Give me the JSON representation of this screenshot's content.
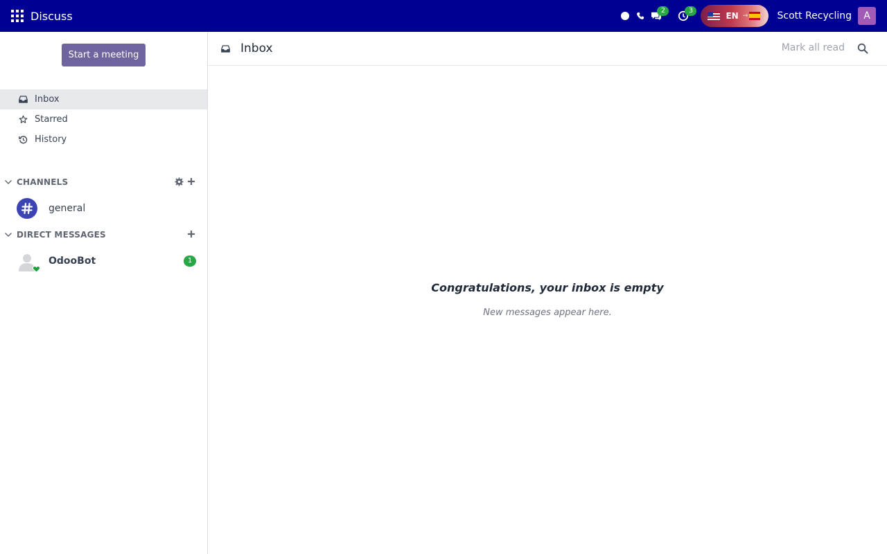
{
  "navbar": {
    "app_name": "Discuss",
    "messages_badge": "2",
    "activities_badge": "3",
    "language": "EN",
    "company": "Scott Recycling",
    "user_initial": "A"
  },
  "sidebar": {
    "start_meeting_label": "Start a meeting",
    "mailboxes": [
      {
        "label": "Inbox",
        "icon": "inbox-icon",
        "active": true
      },
      {
        "label": "Starred",
        "icon": "star-icon"
      },
      {
        "label": "History",
        "icon": "history-icon"
      }
    ],
    "channels": {
      "header": "CHANNELS",
      "items": [
        {
          "name": "general",
          "icon": "hashtag-icon"
        }
      ]
    },
    "direct_messages": {
      "header": "DIRECT MESSAGES",
      "items": [
        {
          "name": "OdooBot",
          "unread": "1",
          "status": "online"
        }
      ]
    }
  },
  "main": {
    "title": "Inbox",
    "mark_all_read": "Mark all read",
    "empty_title": "Congratulations, your inbox is empty",
    "empty_subtitle": "New messages appear here."
  },
  "colors": {
    "navbar": "#000193",
    "primary_button": "#71639e",
    "badge": "#28a745",
    "channel_avatar": "#3c44b4",
    "user_avatar": "#a25ab9"
  }
}
